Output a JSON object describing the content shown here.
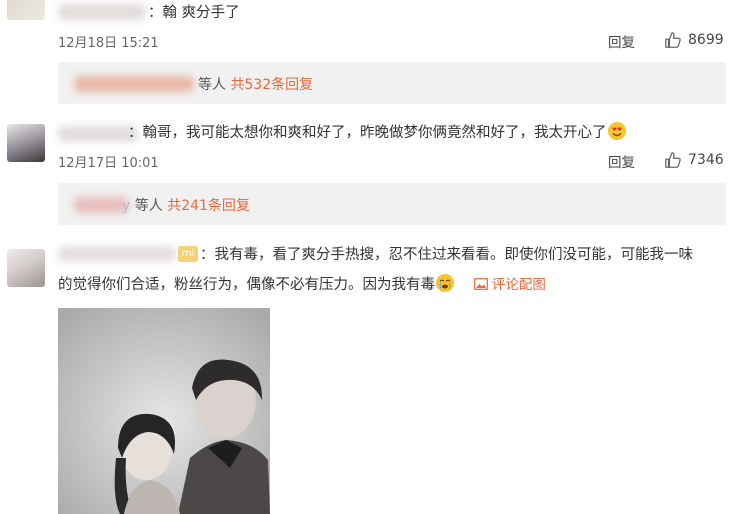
{
  "comments": [
    {
      "text_tail": "：翰 爽分手了",
      "date": "12月18日 15:21",
      "reply_label": "回复",
      "likes": "8699",
      "thread": {
        "suffix": "等人",
        "count": "共532条回复"
      }
    },
    {
      "text_tail": "：翰哥，我可能太想你和爽和好了，昨晚做梦你俩竟然和好了，我太开心了",
      "date": "12月17日 10:01",
      "reply_label": "回复",
      "likes": "7346",
      "thread": {
        "prefix_visible": "y",
        "suffix": "等人",
        "count": "共241条回复"
      }
    },
    {
      "badge": "mi",
      "line1": "：我有毒，看了爽分手热搜，忍不住过来看看。即使你们没可能，可能我一味",
      "line2": "的觉得你们合适，粉丝行为，偶像不必有压力。因为我有毒",
      "attach_label": "评论配图"
    }
  ],
  "icons": {
    "like": "thumbs-up-icon",
    "heart_eyes": "heart-eyes-emoji-icon",
    "crying": "crying-emoji-icon",
    "image": "image-icon"
  },
  "colors": {
    "accent": "#e8683a",
    "reply_bg": "#f1f1f1"
  }
}
